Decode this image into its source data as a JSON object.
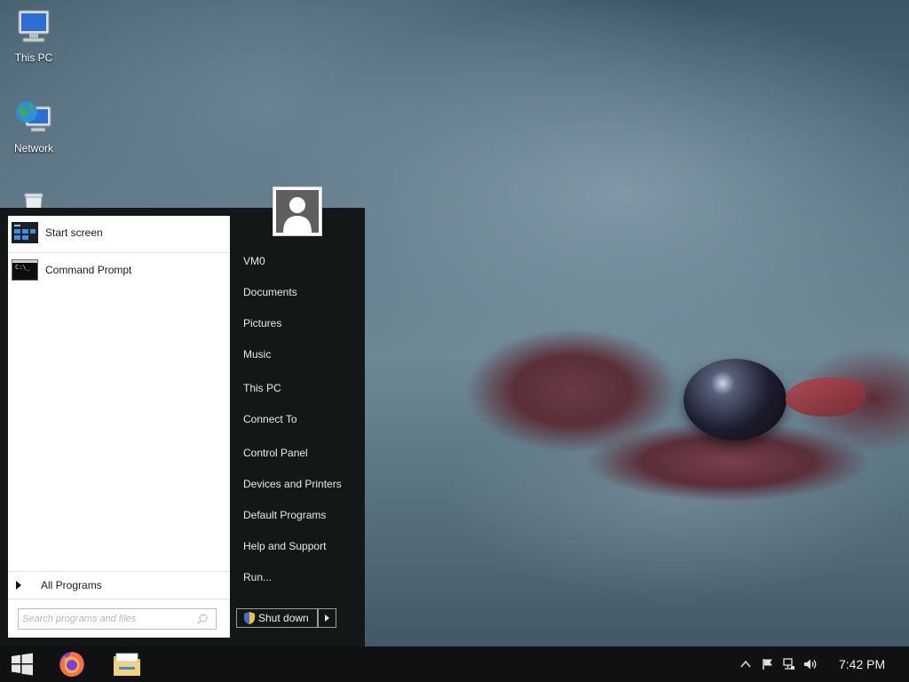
{
  "desktop": {
    "icons": [
      {
        "label": "This PC",
        "icon": "computer-icon"
      },
      {
        "label": "Network",
        "icon": "network-globe-icon"
      },
      {
        "label": "",
        "icon": "recycle-bin-icon"
      }
    ]
  },
  "start_menu": {
    "programs": [
      {
        "label": "Start screen",
        "icon": "start-screen-icon"
      },
      {
        "label": "Command Prompt",
        "icon": "command-prompt-icon"
      }
    ],
    "all_programs_label": "All Programs",
    "search": {
      "placeholder": "Search programs and files",
      "value": ""
    },
    "user_icon": "user-avatar-icon",
    "right_items": [
      "VM0",
      "Documents",
      "Pictures",
      "Music",
      "This PC",
      "Connect To",
      "Control Panel",
      "Devices and Printers",
      "Default Programs",
      "Help and Support",
      "Run..."
    ],
    "shutdown_label": "Shut down"
  },
  "taskbar": {
    "pinned": [
      {
        "icon": "windows-start-icon"
      },
      {
        "icon": "firefox-icon"
      },
      {
        "icon": "file-explorer-icon"
      }
    ],
    "tray_icons": [
      "chevron-up-icon",
      "action-center-flag-icon",
      "network-icon",
      "volume-icon"
    ],
    "clock": "7:42 PM"
  },
  "colors": {
    "start_menu_bg": "#141718",
    "taskbar_bg": "#0f1112",
    "left_pane_bg": "#ffffff"
  }
}
